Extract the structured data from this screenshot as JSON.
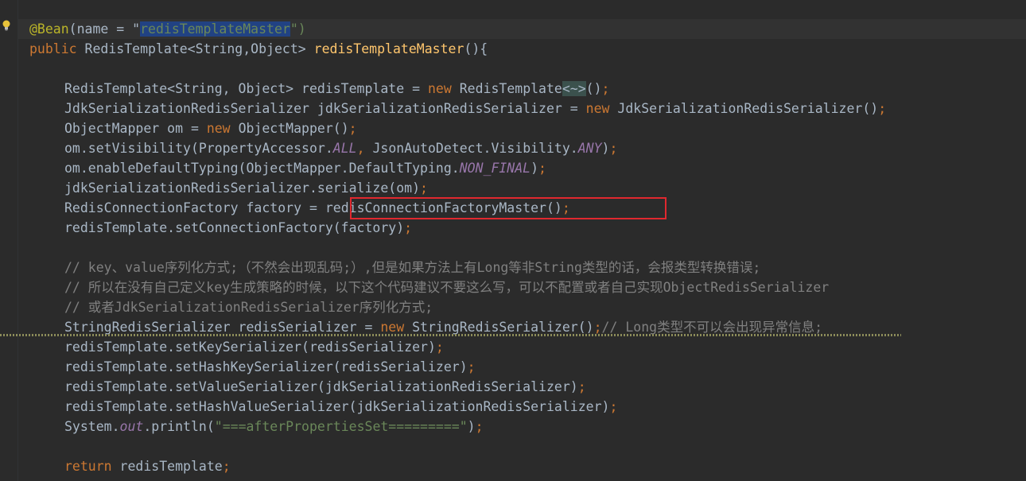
{
  "editor": {
    "colors": {
      "background": "#2b2b2b",
      "keyword": "#cc7832",
      "annotation": "#bbb529",
      "string": "#6a8759",
      "method_decl": "#ffc66d",
      "static_field": "#9876aa",
      "comment": "#808080",
      "text": "#a9b7c6",
      "highlight_box": "#e0282f"
    },
    "gutter_icon": "lightbulb-icon",
    "lines": [
      [
        "@Bean",
        "(name = \"",
        "redisTemplateMaster",
        "\")"
      ],
      [
        "public ",
        "RedisTemplate<String,Object> ",
        "redisTemplateMaster",
        "(){"
      ],
      [],
      [
        "RedisTemplate<String, Object> redisTemplate = ",
        "new ",
        "RedisTemplate",
        "<~>",
        "()",
        ";"
      ],
      [
        "JdkSerializationRedisSerializer jdkSerializationRedisSerializer = ",
        "new ",
        "JdkSerializationRedisSerializer()",
        ";"
      ],
      [
        "ObjectMapper om = ",
        "new ",
        "ObjectMapper()",
        ";"
      ],
      [
        "om.setVisibility(PropertyAccessor.",
        "ALL",
        ", ",
        "JsonAutoDetect.Visibility.",
        "ANY",
        ")",
        ";"
      ],
      [
        "om.enableDefaultTyping(ObjectMapper.DefaultTyping.",
        "NON_FINAL",
        ")",
        ";"
      ],
      [
        "jdkSerializationRedisSerializer.serialize(om)",
        ";"
      ],
      [
        "RedisConnectionFactory factory = ",
        "redisConnectionFactoryMaster()",
        ";"
      ],
      [
        "redisTemplate.setConnectionFactory(factory)",
        ";"
      ],
      [],
      [
        "// key、value序列化方式;（不然会出现乱码;）,但是如果方法上有Long等非String类型的话，会报类型转换错误;"
      ],
      [
        "// 所以在没有自己定义key生成策略的时候，以下这个代码建议不要这么写，可以不配置或者自己实现ObjectRedisSerializer"
      ],
      [
        "// 或者JdkSerializationRedisSerializer序列化方式;"
      ],
      [
        "StringRedisSerializer redisSerializer = ",
        "new ",
        "StringRedisSerializer()",
        ";",
        "// Long类型不可以会出现异常信息;"
      ],
      [
        "redisTemplate.setKeySerializer(redisSerializer)",
        ";"
      ],
      [
        "redisTemplate.setHashKeySerializer(redisSerializer)",
        ";"
      ],
      [
        "redisTemplate.setValueSerializer(jdkSerializationRedisSerializer)",
        ";"
      ],
      [
        "redisTemplate.setHashValueSerializer(jdkSerializationRedisSerializer)",
        ";"
      ],
      [
        "System.",
        "out",
        ".println(",
        "\"===afterPropertiesSet=========\"",
        ")",
        ";"
      ],
      [],
      [
        "return ",
        "redisTemplate",
        ";"
      ]
    ]
  }
}
